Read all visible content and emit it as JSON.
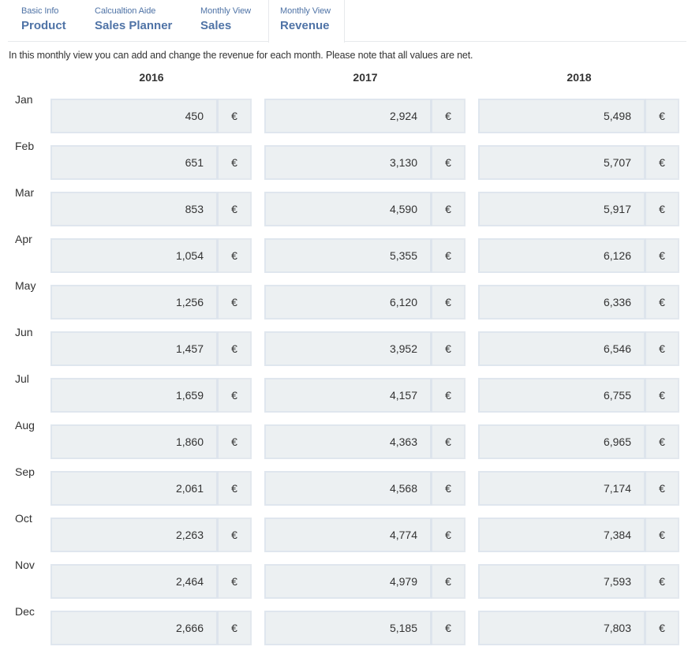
{
  "tabs": [
    {
      "sub": "Basic Info",
      "main": "Product",
      "active": false
    },
    {
      "sub": "Calcualtion Aide",
      "main": "Sales Planner",
      "active": false
    },
    {
      "sub": "Monthly View",
      "main": "Sales",
      "active": false
    },
    {
      "sub": "Monthly View",
      "main": "Revenue",
      "active": true
    }
  ],
  "intro": "In this monthly view you can add and change the revenue for each month. Please note that all values are net.",
  "years": [
    "2016",
    "2017",
    "2018"
  ],
  "currency_symbol": "€",
  "rows": [
    {
      "month": "Jan",
      "values": [
        "450",
        "2,924",
        "5,498"
      ]
    },
    {
      "month": "Feb",
      "values": [
        "651",
        "3,130",
        "5,707"
      ]
    },
    {
      "month": "Mar",
      "values": [
        "853",
        "4,590",
        "5,917"
      ]
    },
    {
      "month": "Apr",
      "values": [
        "1,054",
        "5,355",
        "6,126"
      ]
    },
    {
      "month": "May",
      "values": [
        "1,256",
        "6,120",
        "6,336"
      ]
    },
    {
      "month": "Jun",
      "values": [
        "1,457",
        "3,952",
        "6,546"
      ]
    },
    {
      "month": "Jul",
      "values": [
        "1,659",
        "4,157",
        "6,755"
      ]
    },
    {
      "month": "Aug",
      "values": [
        "1,860",
        "4,363",
        "6,965"
      ]
    },
    {
      "month": "Sep",
      "values": [
        "2,061",
        "4,568",
        "7,174"
      ]
    },
    {
      "month": "Oct",
      "values": [
        "2,263",
        "4,774",
        "7,384"
      ]
    },
    {
      "month": "Nov",
      "values": [
        "2,464",
        "4,979",
        "7,593"
      ]
    },
    {
      "month": "Dec",
      "values": [
        "2,666",
        "5,185",
        "7,803"
      ]
    }
  ]
}
